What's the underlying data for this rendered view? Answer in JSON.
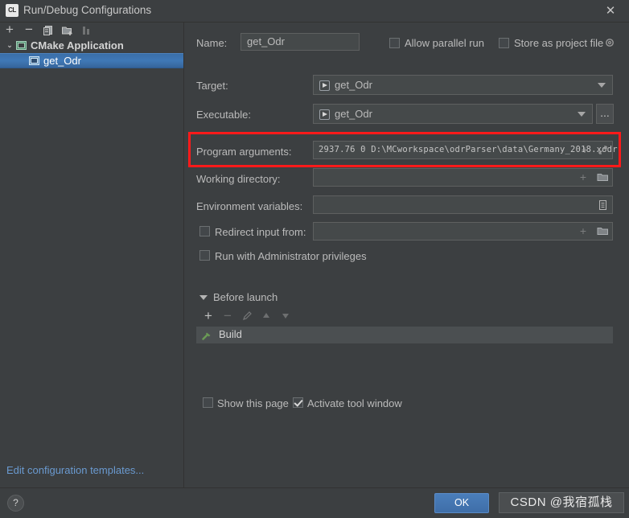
{
  "window": {
    "title": "Run/Debug Configurations",
    "app_icon": "CL",
    "close_icon": "close-icon"
  },
  "sidebar": {
    "toolbar": [
      {
        "name": "add-configuration-button",
        "glyph": "+"
      },
      {
        "name": "remove-configuration-button",
        "glyph": "−"
      },
      {
        "name": "copy-configuration-button",
        "glyph": "copy-icon"
      },
      {
        "name": "new-folder-button",
        "glyph": "folder-add-icon"
      },
      {
        "name": "sort-configurations-button",
        "glyph": "sort-icon"
      }
    ],
    "tree": {
      "group_label": "CMake Application",
      "group_expand_arrow": "⌄",
      "selected_item_label": "get_Odr"
    }
  },
  "form": {
    "name_label": "Name:",
    "name_value": "get_Odr",
    "allow_parallel_run_label": "Allow parallel run",
    "allow_parallel_run_checked": false,
    "store_as_project_file_label": "Store as project file",
    "store_as_project_file_checked": false,
    "store_gear_icon": "gear-icon",
    "target_label": "Target:",
    "target_value": "get_Odr",
    "executable_label": "Executable:",
    "executable_value": "get_Odr",
    "executable_browse_label": "...",
    "program_arguments_label": "Program arguments:",
    "program_arguments_value": "2937.76 0 D:\\MCworkspace\\odrParser\\data\\Germany_2018.xodr",
    "program_arguments_insert_icon": "plus-icon",
    "program_arguments_expand_icon": "expand-icon",
    "working_directory_label": "Working directory:",
    "working_directory_value": "",
    "working_directory_insert_icon": "plus-icon",
    "working_directory_browse_icon": "folder-icon",
    "environment_variables_label": "Environment variables:",
    "environment_variables_value": "",
    "environment_variables_icon": "list-icon",
    "redirect_input_label": "Redirect input from:",
    "redirect_input_checked": false,
    "redirect_input_value": "",
    "redirect_input_insert_icon": "plus-icon",
    "redirect_input_browse_icon": "folder-icon",
    "run_as_admin_label": "Run with Administrator privileges",
    "run_as_admin_checked": false
  },
  "before_launch": {
    "section_label": "Before launch",
    "collapse_arrow": "▾",
    "toolbar": [
      {
        "name": "add-task-button",
        "glyph": "+"
      },
      {
        "name": "remove-task-button",
        "glyph": "−"
      },
      {
        "name": "edit-task-button",
        "glyph": "pencil-icon"
      },
      {
        "name": "move-up-button",
        "glyph": "arrow-up-icon"
      },
      {
        "name": "move-down-button",
        "glyph": "arrow-down-icon"
      }
    ],
    "task_label": "Build",
    "task_icon": "hammer-icon"
  },
  "options": {
    "show_this_page_label": "Show this page",
    "show_this_page_checked": false,
    "activate_tool_window_label": "Activate tool window",
    "activate_tool_window_checked": true
  },
  "footer": {
    "edit_templates_link": "Edit configuration templates...",
    "help_label": "?",
    "ok_label": "OK",
    "watermark_text": "CSDN @我宿孤栈"
  },
  "colors": {
    "background": "#3c3f41",
    "field_background": "#45494a",
    "selection_blue": "#3f78b6",
    "accent_red": "#ff1a1a",
    "link_blue": "#6a9ad0",
    "build_green": "#6a9a55"
  }
}
